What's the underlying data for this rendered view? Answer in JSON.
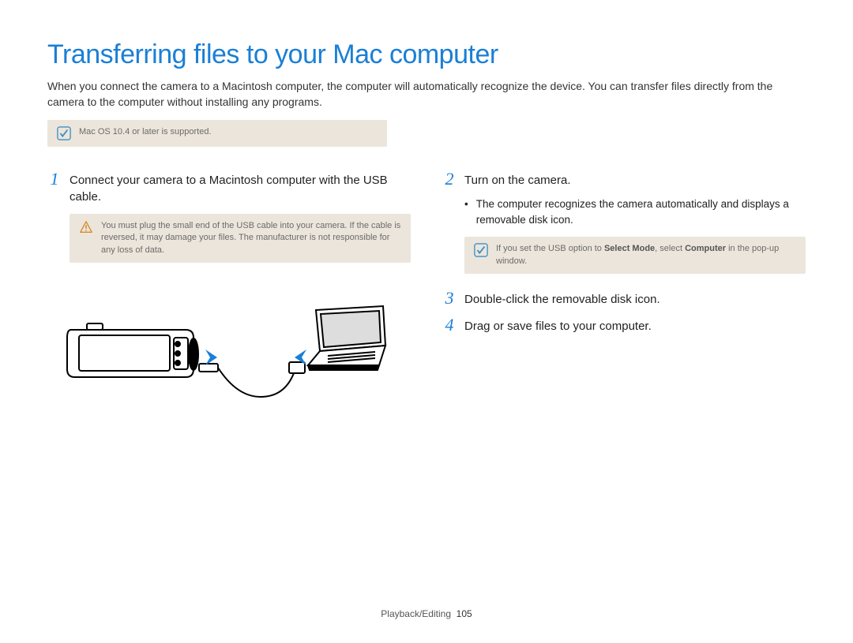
{
  "title": "Transferring files to your Mac computer",
  "intro": "When you connect the camera to a Macintosh computer, the computer will automatically recognize the device. You can transfer files directly from the camera to the computer without installing any programs.",
  "top_note": "Mac OS 10.4 or later is supported.",
  "steps": {
    "s1": {
      "num": "1",
      "text": "Connect your camera to a Macintosh computer with the USB cable."
    },
    "s2": {
      "num": "2",
      "text": "Turn on the camera."
    },
    "s3": {
      "num": "3",
      "text": "Double-click the removable disk icon."
    },
    "s4": {
      "num": "4",
      "text": "Drag or save files to your computer."
    }
  },
  "warning": "You must plug the small end of the USB cable into your camera. If the cable is reversed, it may damage your files. The manufacturer is not responsible for any loss of data.",
  "bullet2": "The computer recognizes the camera automatically and displays a removable disk icon.",
  "note2_pre": "If you set the USB option to ",
  "note2_b1": "Select Mode",
  "note2_mid": ", select ",
  "note2_b2": "Computer",
  "note2_post": " in the pop-up window.",
  "footer_section": "Playback/Editing",
  "footer_page": "105"
}
